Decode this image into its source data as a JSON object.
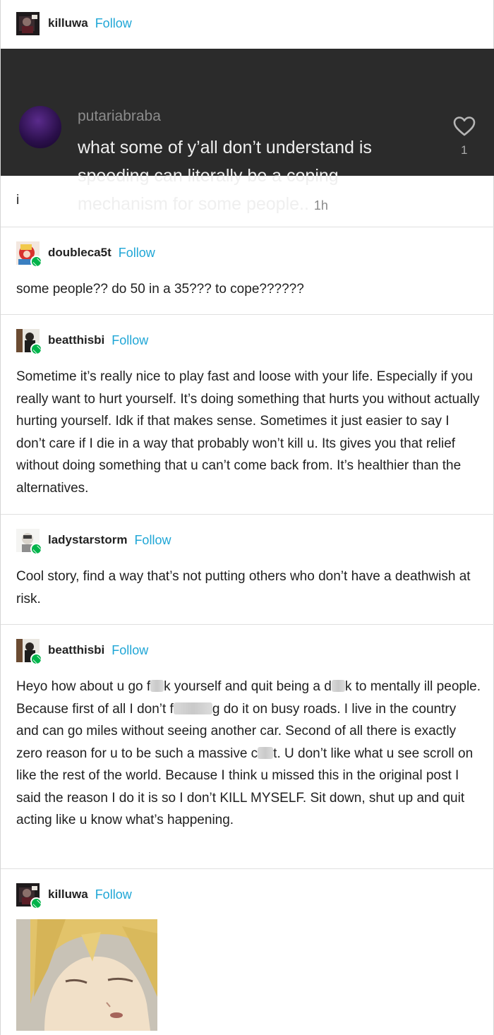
{
  "posts": [
    {
      "username": "killuwa",
      "follow_label": "Follow",
      "screenshot": {
        "username": "putariabraba",
        "text": "what some of y’all don’t understand is speeding can literally be a coping mechanism for some people..",
        "time": "1h",
        "likes": "1"
      },
      "text": "i"
    },
    {
      "username": "doubleca5t",
      "follow_label": "Follow",
      "text": "some people?? do 50 in a 35??? to cope??????"
    },
    {
      "username": "beatthisbi",
      "follow_label": "Follow",
      "text": "Sometime it’s really nice to play fast and loose with your life. Especially if you really want to hurt yourself. It’s doing something that hurts you without actually hurting yourself. Idk if that makes sense. Sometimes it just easier to say I don’t care if I die in a way that probably won’t kill u. Its gives you that relief without doing something that u can’t come back from. It’s healthier than the alternatives."
    },
    {
      "username": "ladystarstorm",
      "follow_label": "Follow",
      "text": "Cool story, find a way that’s not putting others who don’t have a deathwish at risk."
    },
    {
      "username": "beatthisbi",
      "follow_label": "Follow",
      "text_parts": {
        "p1": "Heyo how about u go f",
        "p2": "k yourself and quit being a d",
        "p3": "k to mentally ill people. Because first of all I don’t f",
        "p4": "g do it on busy roads. I live in the country and can go miles without seeing another car. Second of all there is exactly zero reason for u to be such a massive c",
        "p5": "t. U don’t like what u see scroll on like the rest of the world. Because I think u missed this in the original post I said the reason I do it is so I don’t KILL MYSELF. Sit down, shut up and quit acting like u know what’s happening."
      }
    },
    {
      "username": "killuwa",
      "follow_label": "Follow"
    }
  ],
  "colors": {
    "follow": "#1fa6d6",
    "reblog_badge": "#00b34a",
    "screenshot_bg": "#2b2b2b"
  },
  "icons": [
    "heart-icon",
    "reblog-icon"
  ]
}
